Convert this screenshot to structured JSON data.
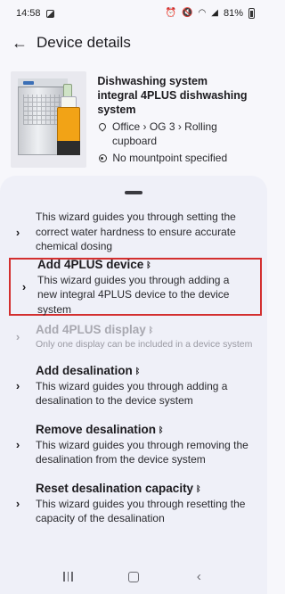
{
  "status_bar": {
    "time": "14:58",
    "battery": "81%"
  },
  "app_bar": {
    "back_icon": "arrow-back-icon",
    "title": "Device details"
  },
  "device": {
    "name": "Dishwashing system",
    "model": "integral 4PLUS dishwashing system",
    "location": "Office › OG 3 › Rolling cupboard",
    "mountpoint": "No mountpoint specified"
  },
  "wizards": [
    {
      "title": "",
      "description": "This wizard guides you through setting the correct water hardness to ensure accurate chemical dosing",
      "bluetooth": false,
      "disabled": false,
      "highlighted": false
    },
    {
      "title": "Add 4PLUS device",
      "description": "This wizard guides you through adding a new integral 4PLUS device to the device system",
      "bluetooth": true,
      "disabled": false,
      "highlighted": true
    },
    {
      "title": "Add 4PLUS display",
      "description": "Only one display can be included in a device system",
      "bluetooth": true,
      "disabled": true,
      "highlighted": false
    },
    {
      "title": "Add desalination",
      "description": "This wizard guides you through adding a desalination to the device system",
      "bluetooth": true,
      "disabled": false,
      "highlighted": false
    },
    {
      "title": "Remove desalination",
      "description": "This wizard guides you through removing the desalination from the device system",
      "bluetooth": true,
      "disabled": false,
      "highlighted": false
    },
    {
      "title": "Reset desalination capacity",
      "description": "This wizard guides you through resetting the capacity of the desalination",
      "bluetooth": true,
      "disabled": false,
      "highlighted": false
    }
  ],
  "colors": {
    "highlight_border": "#d32f2f",
    "sheet_background": "#eff0f8",
    "disabled_text": "#a8a8b0"
  },
  "nav_bar": {
    "recents_icon": "recents-icon",
    "home_icon": "home-icon",
    "back_icon": "nav-back-icon"
  }
}
